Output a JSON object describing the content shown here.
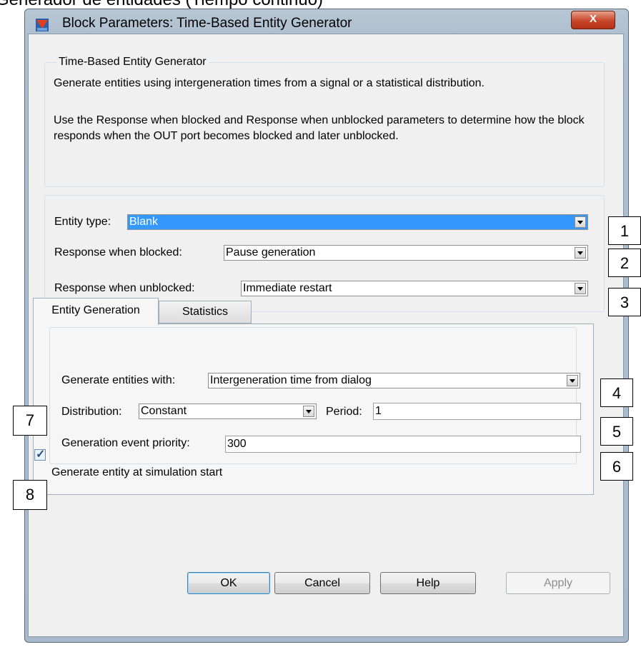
{
  "caption": "Generador de entidades (Tiempo continuo)",
  "window": {
    "title": "Block Parameters: Time-Based Entity Generator",
    "close_label": "X"
  },
  "description": {
    "group_title": "Time-Based Entity Generator",
    "line1": "Generate entities using intergeneration times from a signal or a statistical distribution.",
    "line2": "Use the Response when blocked and Response when unblocked parameters to determine how the block responds when the OUT port becomes blocked and later unblocked."
  },
  "params": {
    "entity_type_label": "Entity type:",
    "entity_type_value": "Blank",
    "blocked_label": "Response when blocked:",
    "blocked_value": "Pause generation",
    "unblocked_label": "Response when unblocked:",
    "unblocked_value": "Immediate restart"
  },
  "tabs": [
    "Entity Generation",
    "Statistics"
  ],
  "generation": {
    "generate_with_label": "Generate entities with:",
    "generate_with_value": "Intergeneration time from dialog",
    "distribution_label": "Distribution:",
    "distribution_value": "Constant",
    "period_label": "Period:",
    "period_value": "1",
    "priority_label": "Generation event priority:",
    "priority_value": "300",
    "start_label": "Generate entity at simulation start",
    "start_checked": true
  },
  "buttons": {
    "ok": "OK",
    "cancel": "Cancel",
    "help": "Help",
    "apply": "Apply"
  },
  "callouts": [
    "1",
    "2",
    "3",
    "4",
    "5",
    "6",
    "7",
    "8"
  ]
}
